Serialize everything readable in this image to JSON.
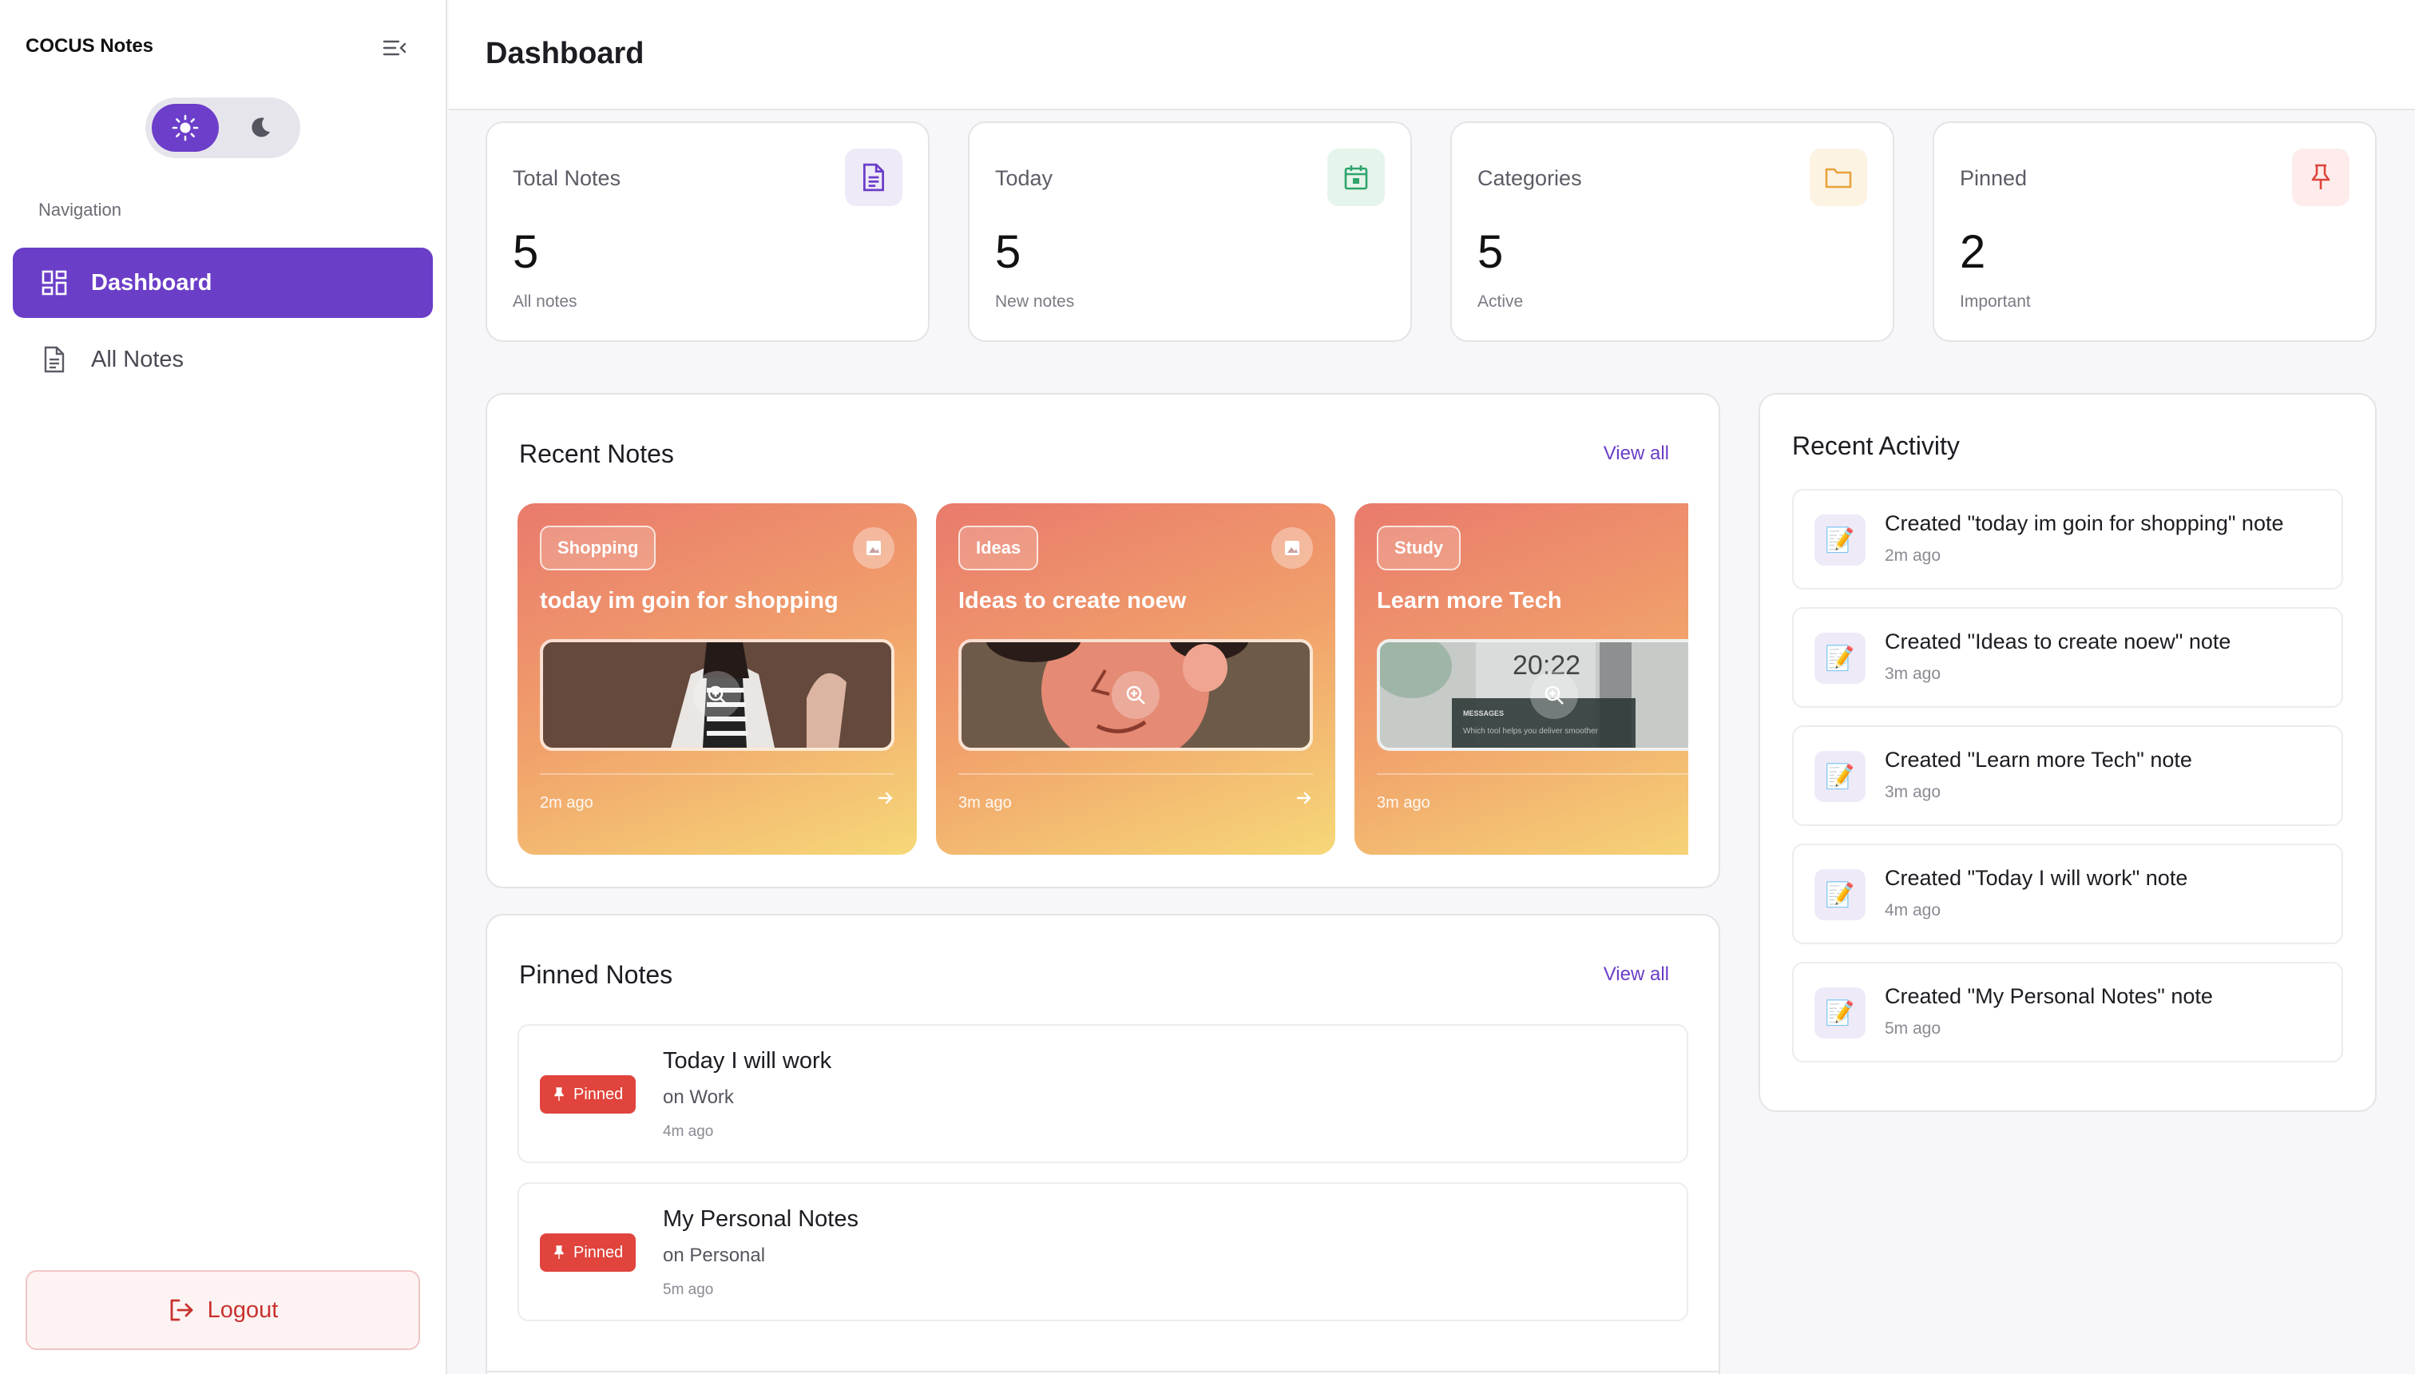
{
  "app": {
    "title": "COCUS Notes"
  },
  "sidebar": {
    "nav_title": "Navigation",
    "items": [
      {
        "label": "Dashboard",
        "icon": "dashboard-icon",
        "active": true
      },
      {
        "label": "All Notes",
        "icon": "document-icon",
        "active": false
      }
    ],
    "logout_label": "Logout",
    "theme": {
      "selected": "light"
    }
  },
  "header": {
    "title": "Dashboard"
  },
  "stats": [
    {
      "label": "Total Notes",
      "value": "5",
      "sub": "All notes",
      "icon": "document-icon",
      "color": "#6b3ec8",
      "bg": "#efeaf8"
    },
    {
      "label": "Today",
      "value": "5",
      "sub": "New notes",
      "icon": "calendar-icon",
      "color": "#2fa36b",
      "bg": "#e6f5ec"
    },
    {
      "label": "Categories",
      "value": "5",
      "sub": "Active",
      "icon": "folder-icon",
      "color": "#e7a23a",
      "bg": "#fdf3e3"
    },
    {
      "label": "Pinned",
      "value": "2",
      "sub": "Important",
      "icon": "pin-icon",
      "color": "#e0443c",
      "bg": "#fdeceb"
    }
  ],
  "recent_notes": {
    "title": "Recent Notes",
    "view_all": "View all",
    "items": [
      {
        "category": "Shopping",
        "title": "today im goin for shopping",
        "time": "2m ago"
      },
      {
        "category": "Ideas",
        "title": "Ideas to create noew",
        "time": "3m ago"
      },
      {
        "category": "Study",
        "title": "Learn more Tech",
        "time": "3m ago",
        "thumb_clock": "20:22",
        "thumb_caption": "MESSAGES",
        "thumb_text": "Which tool helps you deliver smoother"
      }
    ]
  },
  "pinned_notes": {
    "title": "Pinned Notes",
    "view_all": "View all",
    "badge": "Pinned",
    "items": [
      {
        "title": "Today I will work",
        "category": "on Work",
        "time": "4m ago"
      },
      {
        "title": "My Personal Notes",
        "category": "on Personal",
        "time": "5m ago"
      }
    ]
  },
  "activity": {
    "title": "Recent Activity",
    "icon": "📝",
    "items": [
      {
        "text": "Created \"today im goin for shopping\" note",
        "time": "2m ago"
      },
      {
        "text": "Created \"Ideas to create noew\" note",
        "time": "3m ago"
      },
      {
        "text": "Created \"Learn more Tech\" note",
        "time": "3m ago"
      },
      {
        "text": "Created \"Today I will work\" note",
        "time": "4m ago"
      },
      {
        "text": "Created \"My Personal Notes\" note",
        "time": "5m ago"
      }
    ]
  },
  "colors": {
    "accent": "#6b3ec8",
    "danger": "#e0443c"
  }
}
